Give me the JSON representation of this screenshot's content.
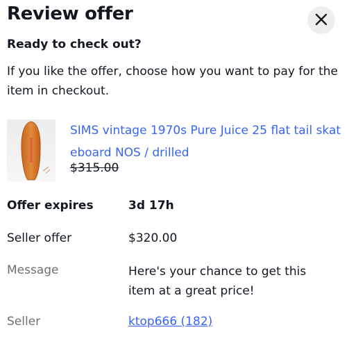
{
  "header": {
    "title": "Review offer",
    "close_icon": "close-icon"
  },
  "subheading": "Ready to check out?",
  "intro": "If you like the offer, choose how you want to pay for the item in checkout.",
  "item": {
    "title": "SIMS vintage 1970s Pure Juice 25 flat tail skateboard  NOS / drilled",
    "original_price": "$315.00",
    "thumbnail_icon": "skateboard-image"
  },
  "details": {
    "offer_expires_label": "Offer expires",
    "offer_expires_value": "3d 17h",
    "seller_offer_label": "Seller offer",
    "seller_offer_value": "$320.00",
    "message_label": "Message",
    "message_value": "Here's your chance to get this item at a great price!",
    "seller_label": "Seller",
    "seller_value": "ktop666 (182)"
  },
  "colors": {
    "link": "#3665f3",
    "text": "#111820",
    "muted": "#707070"
  }
}
